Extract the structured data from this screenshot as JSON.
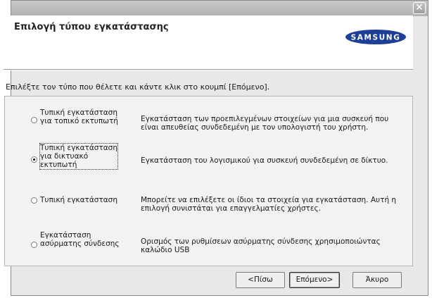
{
  "window": {
    "close_glyph": "✕"
  },
  "header": {
    "title": "Επιλογή τύπου εγκατάστασης",
    "logo_text": "SAMSUNG"
  },
  "instruction": "Επιλέξτε τον τύπο που θέλετε και κάντε κλικ στο κουμπί [Επόμενο].",
  "options": [
    {
      "label": [
        "Τυπική εγκατάσταση",
        "για τοπικό εκτυπωτή"
      ],
      "description": [
        "Εγκατάσταση των προεπιλεγμένων στοιχείων για μια συσκευή που",
        "είναι απευθείας συνδεδεμένη με τον υπολογιστή του χρήστη."
      ],
      "selected": false
    },
    {
      "label": [
        "Τυπική εγκατάσταση",
        "για δικτυακό",
        "εκτυπωτή"
      ],
      "description": [
        "Εγκατάσταση του λογισμικού για συσκευή συνδεδεμένη σε δίκτυο."
      ],
      "selected": true
    },
    {
      "label": [
        "Τυπική εγκατάσταση"
      ],
      "description": [
        "Μπορείτε να επιλέξετε οι ίδιοι τα στοιχεία για εγκατάσταση. Αυτή η",
        "επιλογή συνιστάται για επαγγελματίες χρήστες."
      ],
      "selected": false
    },
    {
      "label": [
        "Εγκατάσταση",
        "ασύρματης σύνδεσης"
      ],
      "description": [
        "Ορισμός των ρυθμίσεων ασύρματης σύνδεσης χρησιμοποιώντας",
        "καλώδιο USB"
      ],
      "selected": false
    }
  ],
  "buttons": {
    "back": "<Πίσω",
    "next": "Επόμενο>",
    "cancel": "Άκυρο"
  },
  "colors": {
    "logo_blue": "#1e3f96",
    "panel_bg": "#f2f2f2",
    "window_bg": "#e8e8e8"
  },
  "icons": {
    "close": "close-icon",
    "radio": "radio-button"
  }
}
